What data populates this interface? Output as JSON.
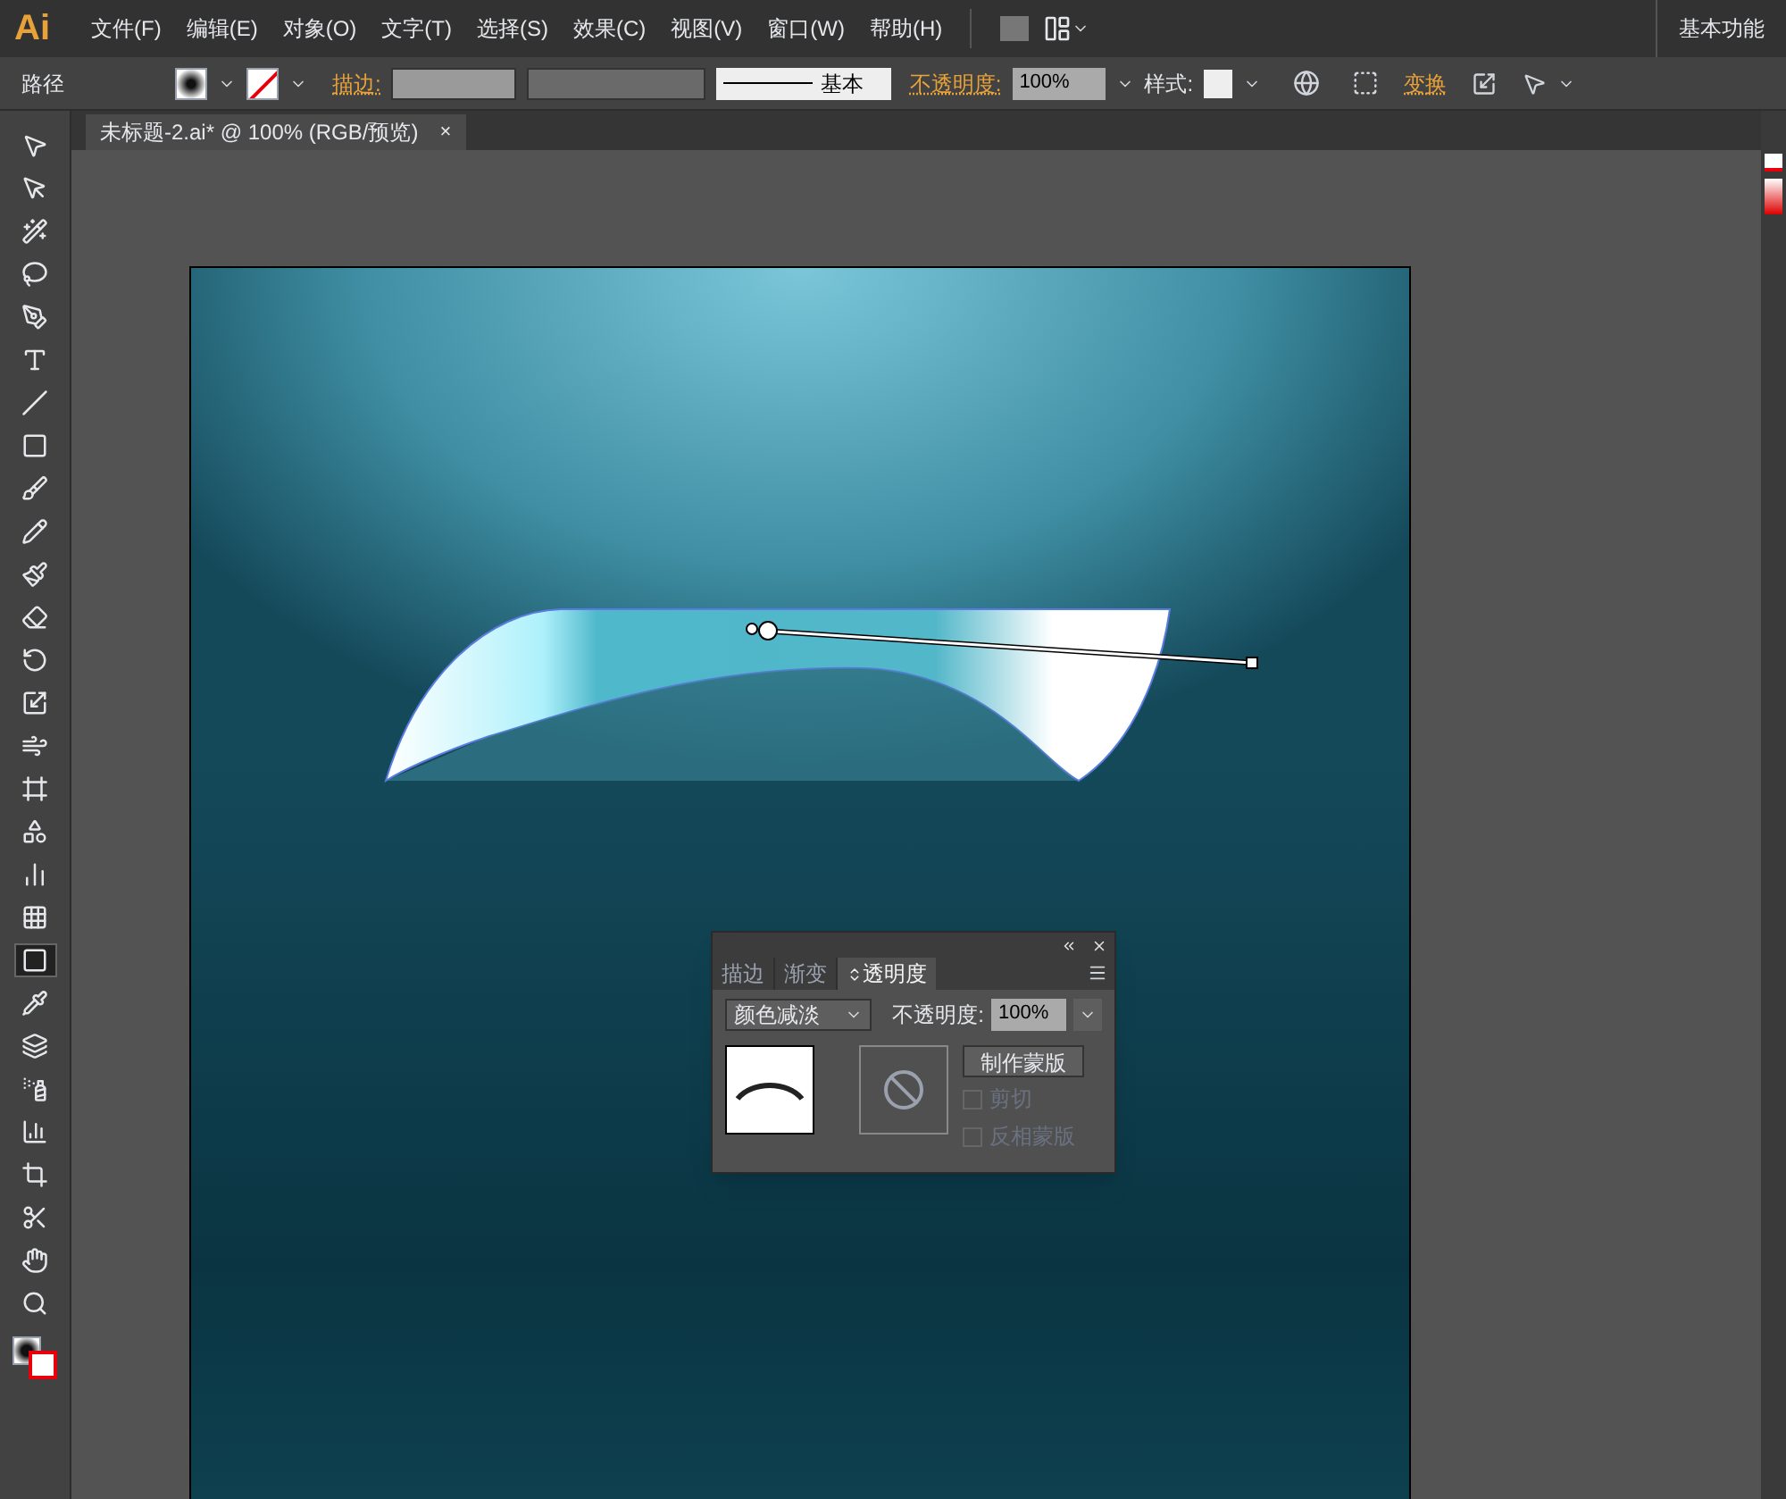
{
  "app": {
    "logo": "Ai",
    "menus": [
      "文件(F)",
      "编辑(E)",
      "对象(O)",
      "文字(T)",
      "选择(S)",
      "效果(C)",
      "视图(V)",
      "窗口(W)",
      "帮助(H)"
    ],
    "workspace": "基本功能"
  },
  "control_bar": {
    "selection": "路径",
    "stroke_label": "描边:",
    "profile": "基本",
    "opacity_label": "不透明度:",
    "opacity": "100%",
    "style_label": "样式:",
    "transform_label": "变换"
  },
  "document_tab": {
    "title": "未标题-2.ai* @ 100% (RGB/预览)",
    "close": "×"
  },
  "tools": [
    {
      "selected": false
    },
    {
      "selected": false
    },
    {
      "selected": false
    },
    {
      "selected": false
    },
    {
      "selected": false
    },
    {
      "selected": false
    },
    {
      "selected": false
    },
    {
      "selected": false
    },
    {
      "selected": false
    },
    {
      "selected": false
    },
    {
      "selected": false
    },
    {
      "selected": false
    },
    {
      "selected": false
    },
    {
      "selected": false
    },
    {
      "selected": false
    },
    {
      "selected": false
    },
    {
      "selected": false
    },
    {
      "selected": false
    },
    {
      "selected": false
    },
    {
      "selected": true
    },
    {
      "selected": false
    },
    {
      "selected": false
    },
    {
      "selected": false
    },
    {
      "selected": false
    },
    {
      "selected": false
    },
    {
      "selected": false
    },
    {
      "selected": false
    },
    {
      "selected": false
    }
  ],
  "transparency_panel": {
    "tabs": [
      {
        "label": "描边",
        "selected": false
      },
      {
        "label": "渐变",
        "selected": false
      },
      {
        "label": "透明度",
        "selected": true
      }
    ],
    "blend_mode": "颜色减淡",
    "opacity_label": "不透明度:",
    "opacity": "100%",
    "make_mask": "制作蒙版",
    "options": [
      {
        "label": "剪切",
        "checked": false,
        "disabled": true
      },
      {
        "label": "反相蒙版",
        "checked": false,
        "disabled": true
      }
    ]
  }
}
